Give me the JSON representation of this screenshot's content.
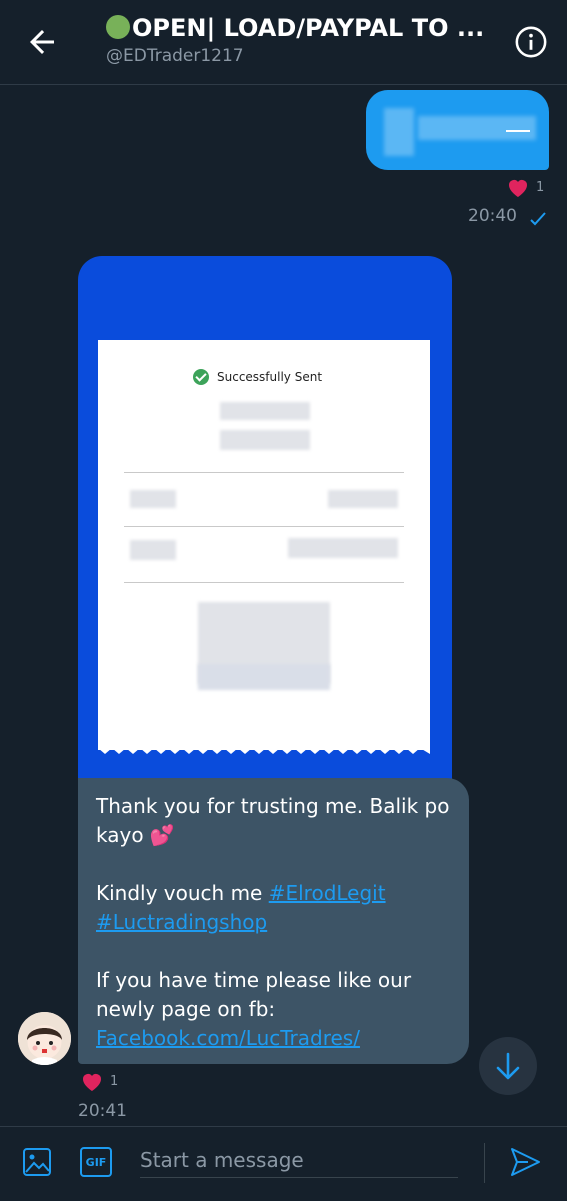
{
  "header": {
    "title": "OPEN| LOAD/PAYPAL TO ...",
    "handle": "@EDTrader1217"
  },
  "outgoing": {
    "reaction_count": "1",
    "time": "20:40"
  },
  "receipt": {
    "status": "Successfully Sent"
  },
  "incoming": {
    "line1": "Thank you for trusting me. Balik po kayo ",
    "emoji": "💕",
    "vouch_prefix": "Kindly vouch me ",
    "tag1": "#ElrodLegit",
    "tag2": "#Luctradingshop",
    "fb_prefix": "If you have time please like our newly page on fb: ",
    "fb_link": "Facebook.com/LucTradres/",
    "reaction_count": "1",
    "time": "20:41"
  },
  "composer": {
    "placeholder": "Start a message",
    "gif_label": "GIF"
  },
  "colors": {
    "background": "#15202b",
    "accent": "#1d9bf0",
    "incoming_bubble": "#3d5466",
    "heart": "#e0245e",
    "status_dot": "#78b159"
  },
  "icons": [
    "back-arrow-icon",
    "info-icon",
    "heart-icon",
    "read-check-icon",
    "success-check-icon",
    "scroll-down-icon",
    "image-icon",
    "gif-icon",
    "send-icon"
  ]
}
